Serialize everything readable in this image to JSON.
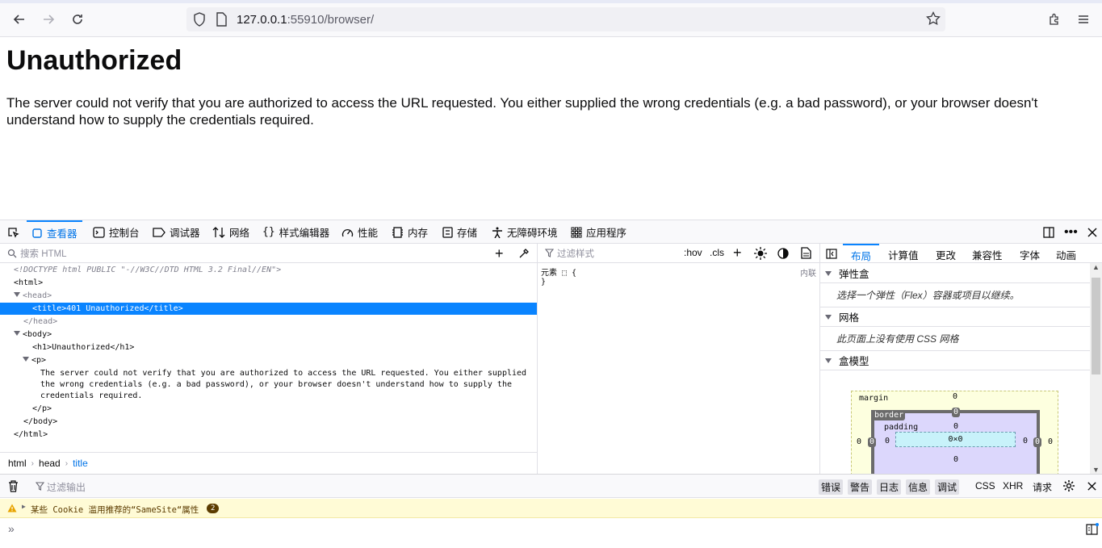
{
  "browser": {
    "url_host": "127.0.0.1",
    "url_rest": ":55910/browser/"
  },
  "page": {
    "heading": "Unauthorized",
    "body": "The server could not verify that you are authorized to access the URL requested. You either supplied the wrong credentials (e.g. a bad password), or your browser doesn't understand how to supply the credentials required."
  },
  "devtools": {
    "tabs": [
      "查看器",
      "控制台",
      "调试器",
      "网络",
      "样式编辑器",
      "性能",
      "内存",
      "存储",
      "无障碍环境",
      "应用程序"
    ],
    "active_tab": "查看器",
    "search_html_placeholder": "搜索 HTML",
    "markup": {
      "doctype": "<!DOCTYPE html PUBLIC \"-//W3C//DTD HTML 3.2 Final//EN\">",
      "html_open": "<html>",
      "head_open": "<head>",
      "title_line": "<title>401 Unauthorized</title>",
      "head_close": "</head>",
      "body_open": "<body>",
      "h1_line": "<h1>Unauthorized</h1>",
      "p_open": "<p>",
      "p_text_1": "The server could not verify that you are authorized to access the URL requested. You either supplied",
      "p_text_2": "the wrong credentials (e.g. a bad password), or your browser doesn't understand how to supply the",
      "p_text_3": "credentials required.",
      "p_close": "</p>",
      "body_close": "</body>",
      "html_close": "</html>"
    },
    "breadcrumbs": [
      "html",
      "head",
      "title"
    ],
    "rules": {
      "filter_placeholder": "过滤样式",
      "hov": ":hov",
      "cls": ".cls",
      "element_rule": "元素 ⬚ {",
      "close_brace": "}",
      "inline": "内联"
    },
    "layout": {
      "tabs": [
        "布局",
        "计算值",
        "更改",
        "兼容性",
        "字体",
        "动画"
      ],
      "active_tab": "布局",
      "flex_title": "弹性盒",
      "flex_msg": "选择一个弹性（Flex）容器或项目以继续。",
      "grid_title": "网格",
      "grid_msg": "此页面上没有使用 CSS 网格",
      "boxmodel_title": "盒模型",
      "margin_label": "margin",
      "border_label": "border",
      "padding_label": "padding",
      "content_size": "0×0",
      "zero": "0"
    },
    "console": {
      "filter_placeholder": "过滤输出",
      "levels": [
        "错误",
        "警告",
        "日志",
        "信息",
        "调试"
      ],
      "types": [
        "CSS",
        "XHR",
        "请求"
      ],
      "warning_text": "某些 Cookie 滥用推荐的“SameSite“属性",
      "warning_count": "2"
    }
  }
}
